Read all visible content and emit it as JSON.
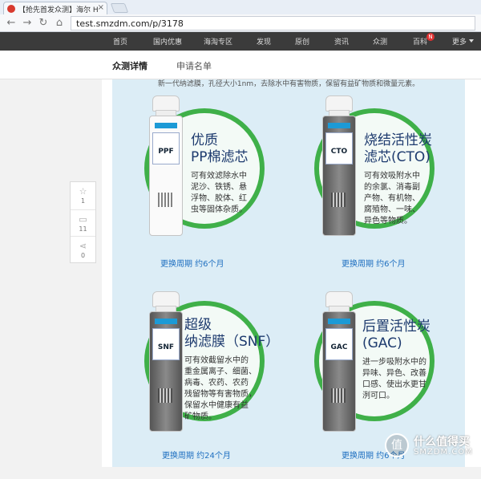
{
  "browser": {
    "tab_title": "【抢先首发众测】海尔 H",
    "url": "test.smzdm.com/p/3178"
  },
  "site_nav": {
    "items": [
      "首页",
      "国内优惠",
      "海淘专区",
      "发现",
      "原创",
      "资讯",
      "众测",
      "百科",
      "更多"
    ],
    "badge": "N"
  },
  "sub_tabs": {
    "active": "众测详情",
    "other": "申请名单"
  },
  "sidebar": {
    "like_count": "1",
    "comment_count": "11",
    "share_count": "0"
  },
  "article": {
    "intro": "新一代纳滤膜，孔径大小1nm，去除水中有害物质，保留有益矿物质和微量元素。",
    "products": [
      {
        "title_lines": [
          "优质",
          "PP棉滤芯"
        ],
        "desc_lines": [
          "可有效滤除水中",
          "泥沙、铁锈、悬",
          "浮物、胶体、红",
          "虫等固体杂质。"
        ],
        "period": "更换周期  约6个月",
        "bottle_label": "PPF"
      },
      {
        "title_lines": [
          "烧结活性炭",
          "滤芯(CTO)"
        ],
        "desc_lines": [
          "可有效吸附水中",
          "的余氯、消毒副",
          "产物、有机物、",
          "腐殖物、一味、",
          "异色等物质。"
        ],
        "period": "更换周期  约6个月",
        "bottle_label": "CTO"
      },
      {
        "title_lines": [
          "超级",
          "纳滤膜（SNF）"
        ],
        "desc_lines": [
          "可有效截留水中的",
          "重金属离子、细菌、",
          "病毒、农药、农药",
          "残留物等有害物质，",
          "保留水中健康有益",
          "矿物质。"
        ],
        "period": "更换周期  约24个月",
        "bottle_label": "SNF"
      },
      {
        "title_lines": [
          "后置活性炭",
          "(GAC)"
        ],
        "desc_lines": [
          "进一步吸附水中的",
          "异味、异色、改善",
          "口感、使出水更甘",
          "洌可口。"
        ],
        "period": "更换周期  约6个月",
        "bottle_label": "GAC"
      }
    ]
  },
  "watermark": {
    "line1": "什么值得买",
    "line2": "SMZDM.COM",
    "glyph": "值"
  },
  "colors": {
    "ring": "#3fb049",
    "title": "#1d3a6e",
    "period": "#1e6fc0",
    "nav_bg": "#3b3b3b"
  }
}
